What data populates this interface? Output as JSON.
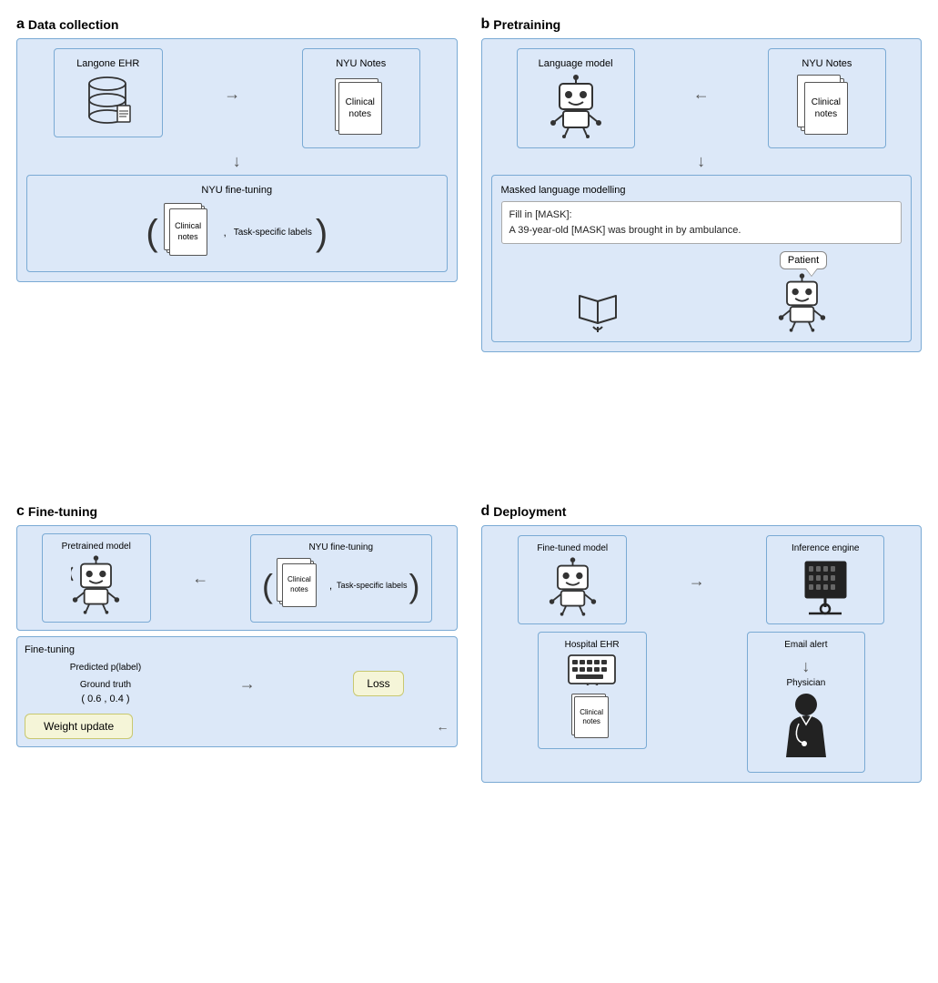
{
  "sections": {
    "a": {
      "letter": "a",
      "title": "Data collection",
      "langone_label": "Langone EHR",
      "nyu_notes_label": "NYU Notes",
      "clinical_notes_label": "Clinical notes",
      "fine_tuning_label": "NYU fine-tuning",
      "task_labels_label": "Task-specific labels"
    },
    "b": {
      "letter": "b",
      "title": "Pretraining",
      "language_model_label": "Language model",
      "nyu_notes_label": "NYU Notes",
      "clinical_notes_label": "Clinical notes",
      "masked_lm_label": "Masked language modelling",
      "fill_in_text": "Fill in [MASK]:",
      "example_text": "A 39-year-old [MASK] was brought in by ambulance.",
      "patient_bubble": "Patient"
    },
    "c": {
      "letter": "c",
      "title": "Fine-tuning",
      "pretrained_model_label": "Pretrained model",
      "nyu_fine_tuning_label": "NYU fine-tuning",
      "clinical_notes_label": "Clinical notes",
      "task_labels_label": "Task-specific labels",
      "fine_tuning_section_label": "Fine-tuning",
      "predicted_label": "Predicted p(label)",
      "values_label": "( 0.6 , 0.4 )",
      "ground_truth_label": "Ground truth",
      "loss_label": "Loss",
      "weight_update_label": "Weight update"
    },
    "d": {
      "letter": "d",
      "title": "Deployment",
      "finetuned_model_label": "Fine-tuned model",
      "inference_engine_label": "Inference engine",
      "hospital_ehr_label": "Hospital EHR",
      "email_alert_label": "Email alert",
      "physician_label": "Physician",
      "clinical_notes_label": "Clinical notes"
    }
  }
}
